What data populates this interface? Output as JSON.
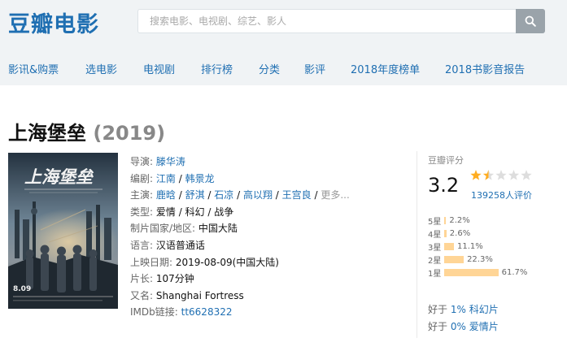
{
  "header": {
    "logo": "豆瓣电影",
    "search_placeholder": "搜索电影、电视剧、综艺、影人"
  },
  "nav": [
    "影讯&购票",
    "选电影",
    "电视剧",
    "排行榜",
    "分类",
    "影评",
    "2018年度榜单",
    "2018书影音报告"
  ],
  "movie": {
    "title": "上海堡垒",
    "year": "(2019)",
    "poster_title": "上海堡垒",
    "poster_date": "8.09",
    "info": {
      "director_label": "导演:",
      "director": "滕华涛",
      "writer_label": "编剧:",
      "writers": [
        "江南",
        "韩景龙"
      ],
      "cast_label": "主演:",
      "cast": [
        "鹿晗",
        "舒淇",
        "石凉",
        "高以翔",
        "王宫良"
      ],
      "cast_more": "更多...",
      "genre_label": "类型:",
      "genres": "爱情 / 科幻 / 战争",
      "region_label": "制片国家/地区:",
      "region": "中国大陆",
      "language_label": "语言:",
      "language": "汉语普通话",
      "release_label": "上映日期:",
      "release": "2019-08-09(中国大陆)",
      "runtime_label": "片长:",
      "runtime": "107分钟",
      "aka_label": "又名:",
      "aka": "Shanghai Fortress",
      "imdb_label": "IMDb链接:",
      "imdb": "tt6628322"
    }
  },
  "rating": {
    "header": "豆瓣评分",
    "score": "3.2",
    "stars_filled": 1.5,
    "votes": "139258人评价",
    "distribution": [
      {
        "label": "5星",
        "pct": "2.2%",
        "value": 2.2
      },
      {
        "label": "4星",
        "pct": "2.6%",
        "value": 2.6
      },
      {
        "label": "3星",
        "pct": "11.1%",
        "value": 11.1
      },
      {
        "label": "2星",
        "pct": "22.3%",
        "value": 22.3
      },
      {
        "label": "1星",
        "pct": "61.7%",
        "value": 61.7
      }
    ],
    "better_than": [
      {
        "prefix": "好于 ",
        "pct": "1%",
        "genre": " 科幻片"
      },
      {
        "prefix": "好于 ",
        "pct": "0%",
        "genre": " 爱情片"
      }
    ]
  },
  "colors": {
    "brand": "#1f6fb2",
    "star": "#ffad21",
    "bar": "#ffd596",
    "header_bg": "#f0f3f5"
  }
}
